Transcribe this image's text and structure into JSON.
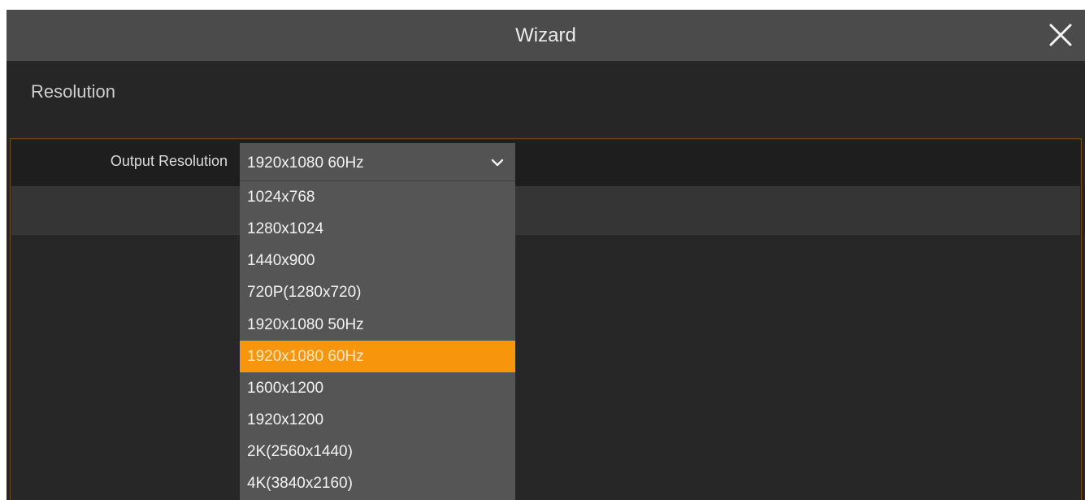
{
  "window": {
    "title": "Wizard",
    "close_icon": "close-icon"
  },
  "section": {
    "label": "Resolution"
  },
  "output_resolution": {
    "label": "Output Resolution",
    "selected_value": "1920x1080 60Hz",
    "chevron_icon": "chevron-down-icon",
    "options": [
      {
        "label": "1024x768"
      },
      {
        "label": "1280x1024"
      },
      {
        "label": "1440x900"
      },
      {
        "label": "720P(1280x720)"
      },
      {
        "label": "1920x1080 50Hz"
      },
      {
        "label": "1920x1080 60Hz",
        "selected": true
      },
      {
        "label": "1600x1200"
      },
      {
        "label": "1920x1200"
      },
      {
        "label": "2K(2560x1440)"
      },
      {
        "label": "4K(3840x2160)"
      }
    ]
  },
  "colors": {
    "accent": "#f7950c",
    "titlebar": "#4b4b4b",
    "background": "#262626"
  }
}
